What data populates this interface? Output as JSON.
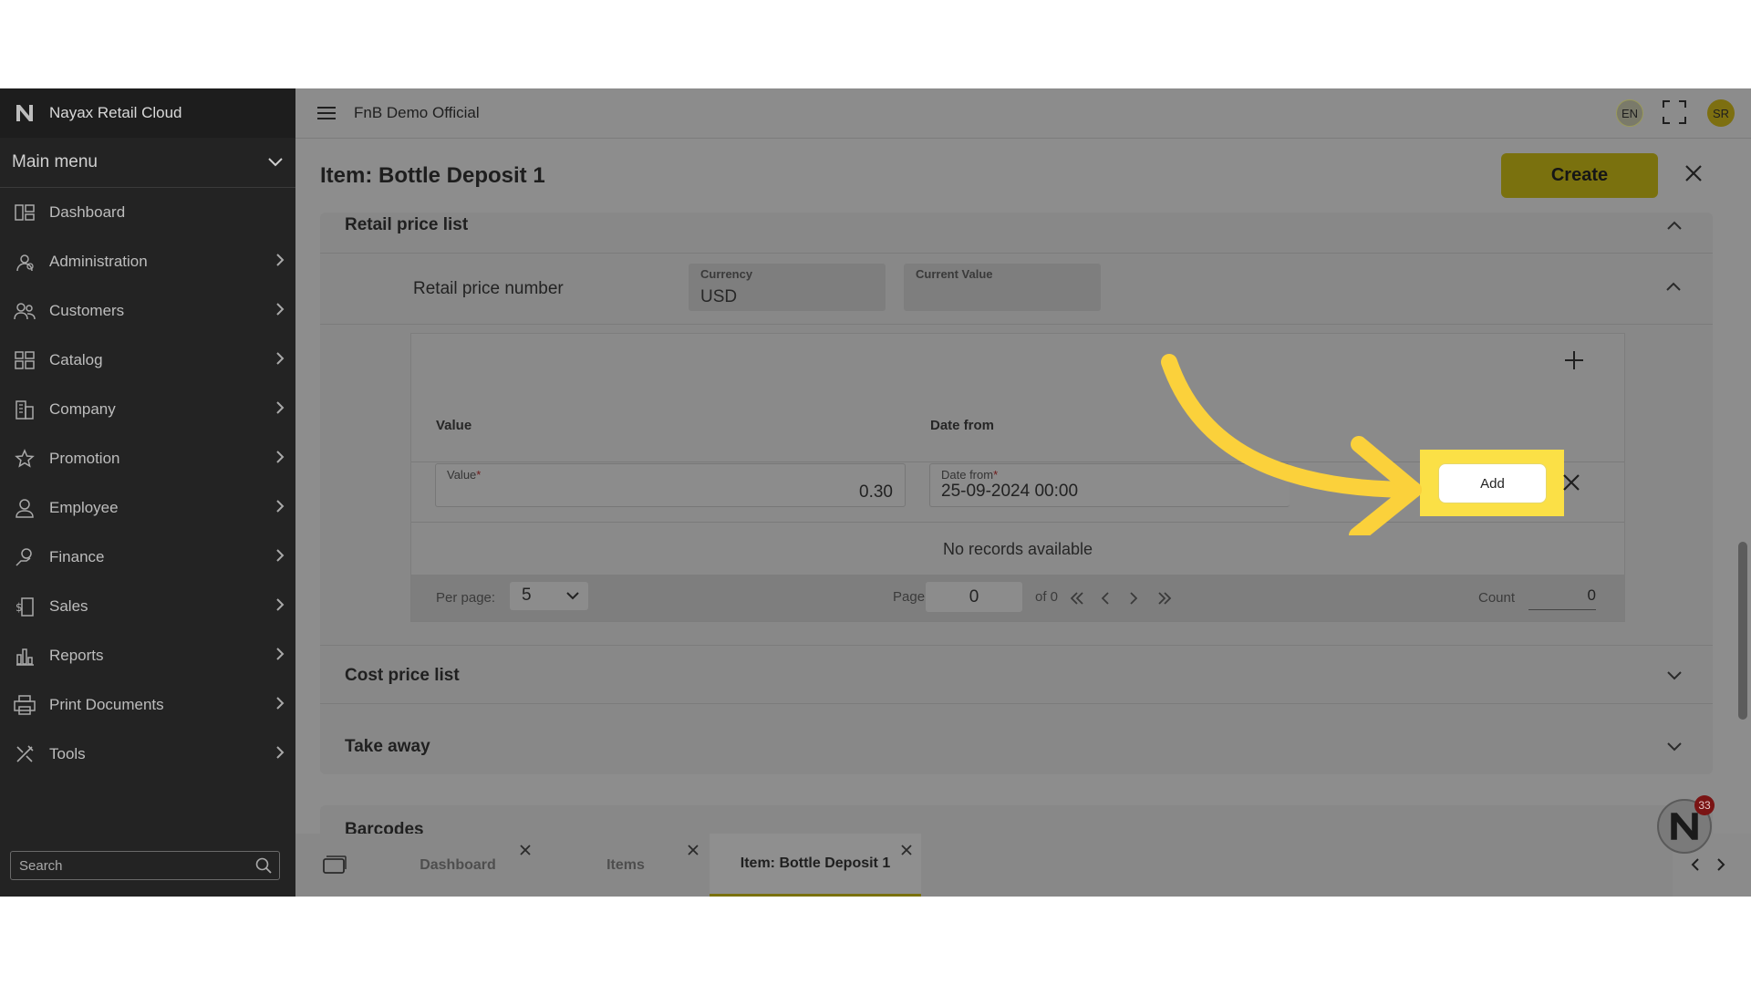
{
  "sidebar": {
    "brand": "Nayax Retail Cloud",
    "main_menu": "Main menu",
    "items": [
      {
        "label": "Dashboard",
        "icon": "dashboard-icon",
        "has_children": false
      },
      {
        "label": "Administration",
        "icon": "admin-gear-icon",
        "has_children": true
      },
      {
        "label": "Customers",
        "icon": "customers-icon",
        "has_children": true
      },
      {
        "label": "Catalog",
        "icon": "catalog-icon",
        "has_children": true
      },
      {
        "label": "Company",
        "icon": "company-icon",
        "has_children": true
      },
      {
        "label": "Promotion",
        "icon": "star-icon",
        "has_children": true
      },
      {
        "label": "Employee",
        "icon": "employee-icon",
        "has_children": true
      },
      {
        "label": "Finance",
        "icon": "finance-icon",
        "has_children": true
      },
      {
        "label": "Sales",
        "icon": "sales-icon",
        "has_children": true
      },
      {
        "label": "Reports",
        "icon": "reports-icon",
        "has_children": true
      },
      {
        "label": "Print Documents",
        "icon": "printer-icon",
        "has_children": true
      },
      {
        "label": "Tools",
        "icon": "tools-icon",
        "has_children": true
      }
    ],
    "search_placeholder": "Search"
  },
  "topbar": {
    "org_name": "FnB Demo Official",
    "language": "EN",
    "avatar_initials": "SR"
  },
  "page": {
    "title": "Item: Bottle Deposit 1",
    "create_label": "Create"
  },
  "retail_price_list": {
    "title": "Retail price list",
    "number_label": "Retail price number",
    "currency_label": "Currency",
    "currency_value": "USD",
    "current_value_label": "Current Value",
    "current_value": "",
    "table": {
      "col_value": "Value",
      "col_date_from": "Date from",
      "value_field_label": "Value",
      "value_field_value": "0.30",
      "date_field_label": "Date from",
      "date_field_value": "25-09-2024 00:00",
      "add_label": "Add",
      "no_records": "No records available",
      "per_page_label": "Per page:",
      "per_page_value": "5",
      "page_label": "Page",
      "page_value": "0",
      "of_label": "of 0",
      "count_label": "Count",
      "count_value": "0"
    }
  },
  "sections": {
    "cost_price_list": "Cost price list",
    "take_away": "Take away",
    "barcodes": "Barcodes"
  },
  "tabs": [
    {
      "label": "Dashboard",
      "active": false
    },
    {
      "label": "Items",
      "active": false
    },
    {
      "label": "Item: Bottle Deposit 1",
      "active": true
    }
  ],
  "notifications": {
    "count": "33"
  },
  "colors": {
    "accent": "#fbe046",
    "create_button_dimmed": "#7a710e",
    "sidebar_bg": "#232323"
  }
}
